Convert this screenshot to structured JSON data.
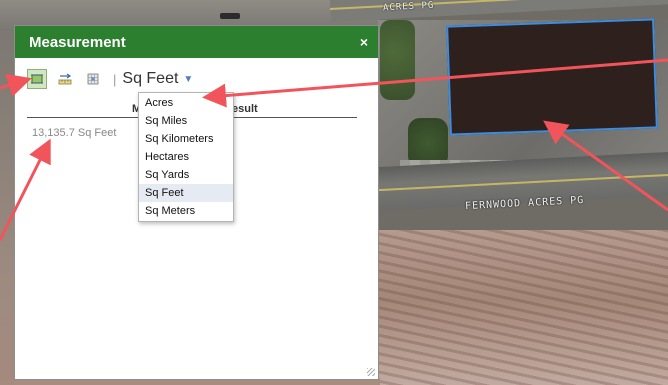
{
  "panel": {
    "title": "Measurement",
    "close_glyph": "×"
  },
  "toolbar": {
    "tools": [
      {
        "icon": "area-tool-icon",
        "active": true
      },
      {
        "icon": "distance-tool-icon",
        "active": false
      },
      {
        "icon": "location-tool-icon",
        "active": false
      }
    ],
    "separator": "|",
    "unit_selected": "Sq Feet",
    "caret": "▼"
  },
  "results": {
    "header_measurement_visible": "M",
    "header_result_visible": "esult",
    "value": "13,135.7 Sq Feet"
  },
  "unit_options": [
    "Acres",
    "Sq Miles",
    "Sq Kilometers",
    "Hectares",
    "Sq Yards",
    "Sq Feet",
    "Sq Meters"
  ],
  "unit_selected_index": 5,
  "map": {
    "road_label_bottom": "FERNWOOD ACRES PG",
    "road_label_top": "ACRES PG"
  },
  "colors": {
    "header_bg": "#2c7f2f",
    "polygon_fill": "#2e211d",
    "polygon_stroke": "#3a8de0",
    "arrow": "#f2545b"
  }
}
